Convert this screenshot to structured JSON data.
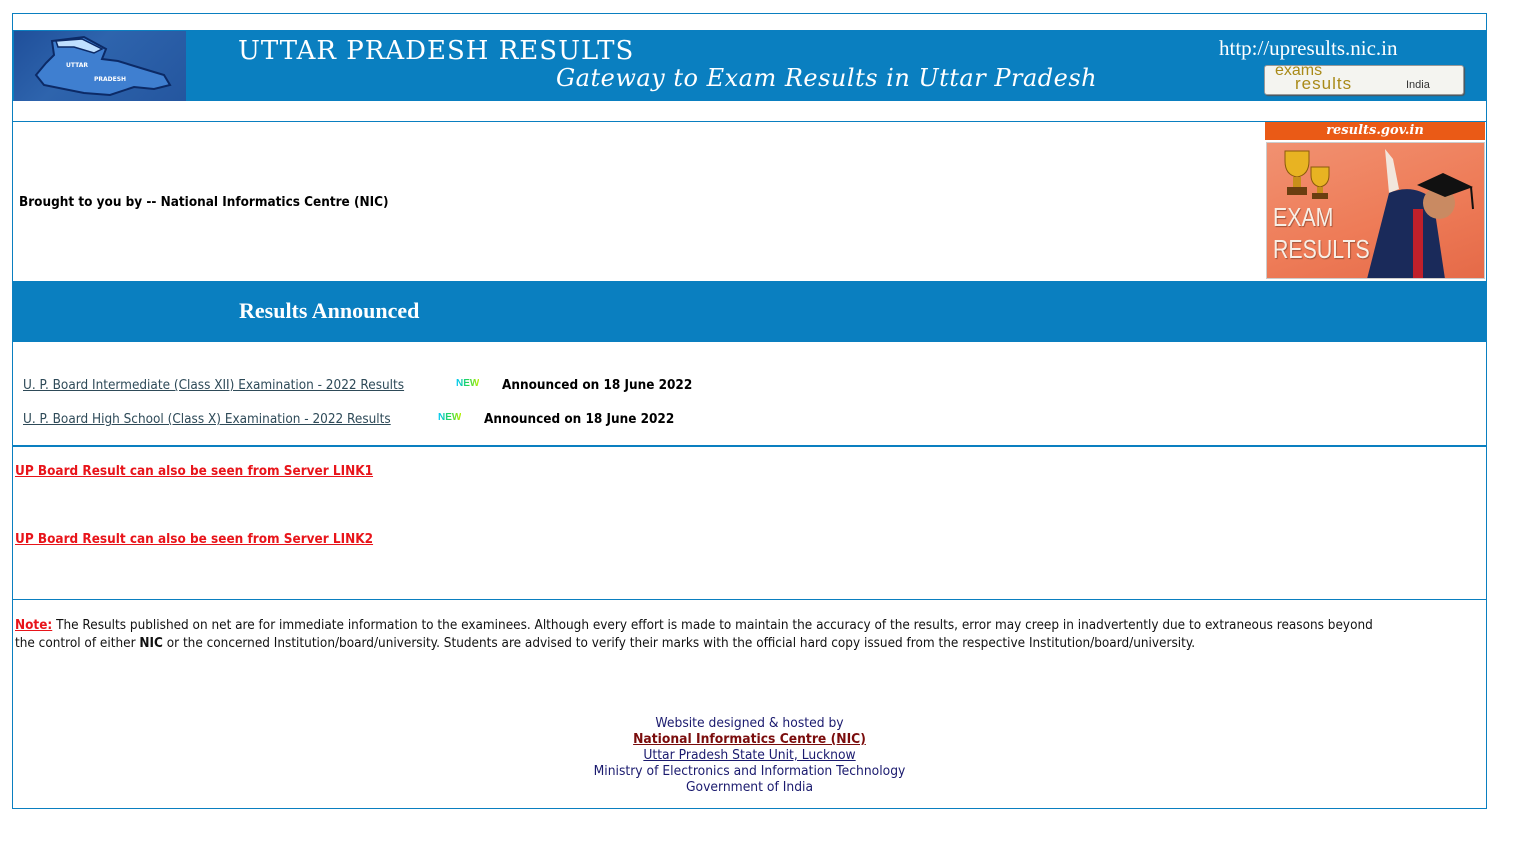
{
  "header": {
    "logo_label_1": "UTTAR",
    "logo_label_2": "PRADESH",
    "title": "UTTAR PRADESH RESULTS",
    "subtitle": "Gateway to Exam Results in Uttar Pradesh",
    "url": "http://upresults.nic.in",
    "badge": {
      "line1": "exams",
      "line2": "results",
      "line3": "India"
    }
  },
  "intro": {
    "brought_by": "Brought to you by -- National Informatics Centre (NIC)",
    "promo": {
      "heading": "results.gov.in",
      "text1": "EXAM",
      "text2": "RESULTS"
    }
  },
  "announced": {
    "title": "Results Announced",
    "items": [
      {
        "label": "U. P. Board Intermediate (Class XII) Examination - 2022 Results",
        "badge": "NEW",
        "status": "Announced on 18 June 2022"
      },
      {
        "label": "U. P. Board High School (Class X) Examination - 2022 Results",
        "badge": "NEW",
        "status": "Announced on 18 June 2022"
      }
    ]
  },
  "servers": {
    "link1": "UP Board Result can also be seen from Server LINK1",
    "link2": "UP Board Result can also be seen from Server LINK2"
  },
  "note": {
    "label": "Note:",
    "line1_text": " The Results published on net are for immediate information to the examinees. Although every effort is made to maintain the accuracy of the results, error may creep in inadvertently due to extraneous reasons beyond",
    "line2_pre": "the control of either ",
    "line2_bold": "NIC",
    "line2_post": " or the concerned Institution/board/university. Students are advised to verify their marks with the official hard copy issued from the respective Institution/board/university."
  },
  "footer": {
    "line1": "Website designed & hosted by",
    "nic_link": "National Informatics Centre (NIC)",
    "unit_link": "Uttar Pradesh State Unit, Lucknow",
    "ministry": "Ministry of Electronics and Information Technology",
    "government": "Government of India"
  },
  "colors": {
    "brand_blue": "#0a7fc0",
    "link_red": "#e8141a",
    "promo_orange": "#ea5a16",
    "footer_navy": "#1a1a6e",
    "nic_maroon": "#7a0c0c"
  }
}
